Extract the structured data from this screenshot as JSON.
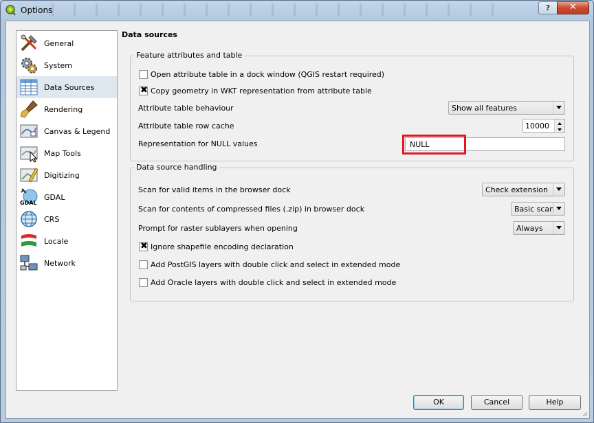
{
  "window": {
    "title": "Options",
    "help_label": "?",
    "close_label": "✕"
  },
  "sidebar": {
    "items": [
      {
        "label": "General",
        "icon": "tools-icon"
      },
      {
        "label": "System",
        "icon": "gears-icon"
      },
      {
        "label": "Data Sources",
        "icon": "table-icon",
        "selected": true
      },
      {
        "label": "Rendering",
        "icon": "paintbrush-icon"
      },
      {
        "label": "Canvas & Legend",
        "icon": "map-canvas-icon"
      },
      {
        "label": "Map Tools",
        "icon": "map-tools-icon"
      },
      {
        "label": "Digitizing",
        "icon": "digitizing-icon"
      },
      {
        "label": "GDAL",
        "icon": "gdal-icon",
        "icon_text": "GDAL"
      },
      {
        "label": "CRS",
        "icon": "globe-icon"
      },
      {
        "label": "Locale",
        "icon": "flag-icon"
      },
      {
        "label": "Network",
        "icon": "network-icon"
      }
    ]
  },
  "page": {
    "heading": "Data sources",
    "feature_group": {
      "title": "Feature attributes and table",
      "open_dock_label": "Open attribute table in a dock window (QGIS restart required)",
      "open_dock_checked": false,
      "copy_wkt_label": "Copy geometry in WKT representation from attribute table",
      "copy_wkt_checked": true,
      "behaviour_label": "Attribute table behaviour",
      "behaviour_value": "Show all features",
      "row_cache_label": "Attribute table row cache",
      "row_cache_value": "10000",
      "null_label": "Representation for NULL values",
      "null_value": "NULL"
    },
    "handling_group": {
      "title": "Data source handling",
      "scan_label": "Scan for valid items in the browser dock",
      "scan_value": "Check extension",
      "zip_label": "Scan for contents of compressed files (.zip) in browser dock",
      "zip_value": "Basic scan",
      "sublayers_label": "Prompt for raster sublayers when opening",
      "sublayers_value": "Always",
      "ignore_shp_label": "Ignore shapefile encoding declaration",
      "ignore_shp_checked": true,
      "postgis_label": "Add PostGIS layers with double click and select in extended mode",
      "postgis_checked": false,
      "oracle_label": "Add Oracle layers with double click and select in extended mode",
      "oracle_checked": false
    }
  },
  "buttons": {
    "ok": "OK",
    "cancel": "Cancel",
    "help": "Help"
  },
  "check_mark": "✖",
  "colors": {
    "highlight": "#e0171f",
    "selected_item": "#dfe7f0"
  }
}
